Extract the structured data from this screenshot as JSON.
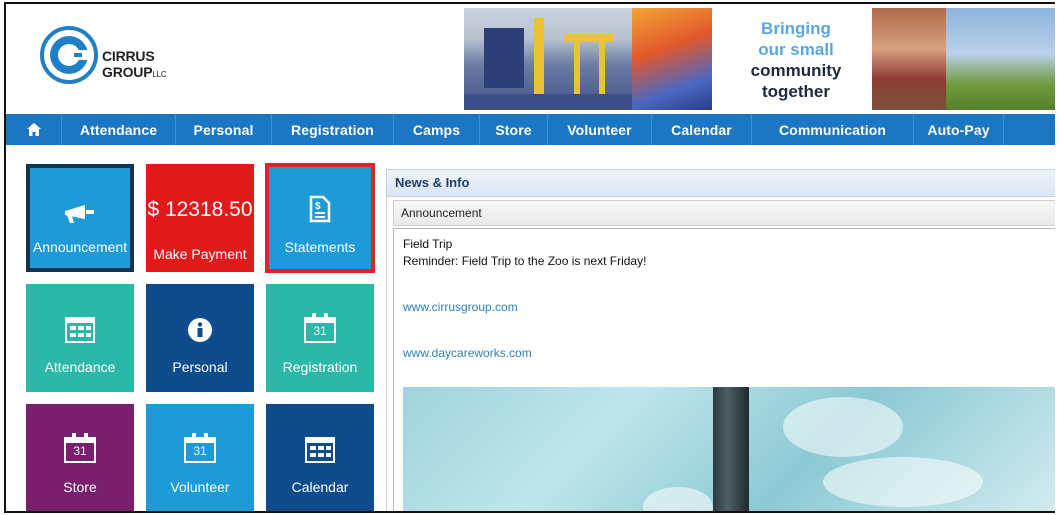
{
  "brand": {
    "name": "CIRRUS GROUP",
    "suffix": "LLC"
  },
  "banner": {
    "slogan": [
      "Bringing",
      "our small",
      "community",
      "together"
    ]
  },
  "nav": {
    "items": [
      "Attendance",
      "Personal",
      "Registration",
      "Camps",
      "Store",
      "Volunteer",
      "Calendar",
      "Communication",
      "Auto-Pay"
    ]
  },
  "tiles": {
    "announcement": {
      "label": "Announcement",
      "icon": "megaphone-icon",
      "color": "#1e9bd7"
    },
    "payment": {
      "amount": "$ 12318.50",
      "label": "Make Payment",
      "color": "#e0191b"
    },
    "statements": {
      "label": "Statements",
      "icon": "document-dollar-icon",
      "color": "#1e9bd7"
    },
    "attendance": {
      "label": "Attendance",
      "icon": "calendar-grid-icon",
      "color": "#2cb8a8"
    },
    "personal": {
      "label": "Personal",
      "icon": "info-icon",
      "color": "#0f4c8c"
    },
    "registration": {
      "label": "Registration",
      "icon": "calendar-31-icon",
      "color": "#2cb8a8",
      "day": "31"
    },
    "store": {
      "label": "Store",
      "icon": "calendar-31-icon",
      "color": "#7a1e6e",
      "day": "31"
    },
    "volunteer": {
      "label": "Volunteer",
      "icon": "calendar-31-icon",
      "color": "#1e9bd7",
      "day": "31"
    },
    "calendar": {
      "label": "Calendar",
      "icon": "calendar-grid-icon",
      "color": "#0f4c8c"
    }
  },
  "panel": {
    "title": "News & Info",
    "tab": "Announcement",
    "announcement_title": "Field Trip",
    "announcement_body": "Reminder: Field Trip to the Zoo is next Friday!",
    "links": [
      "www.cirrusgroup.com",
      "www.daycareworks.com"
    ]
  }
}
